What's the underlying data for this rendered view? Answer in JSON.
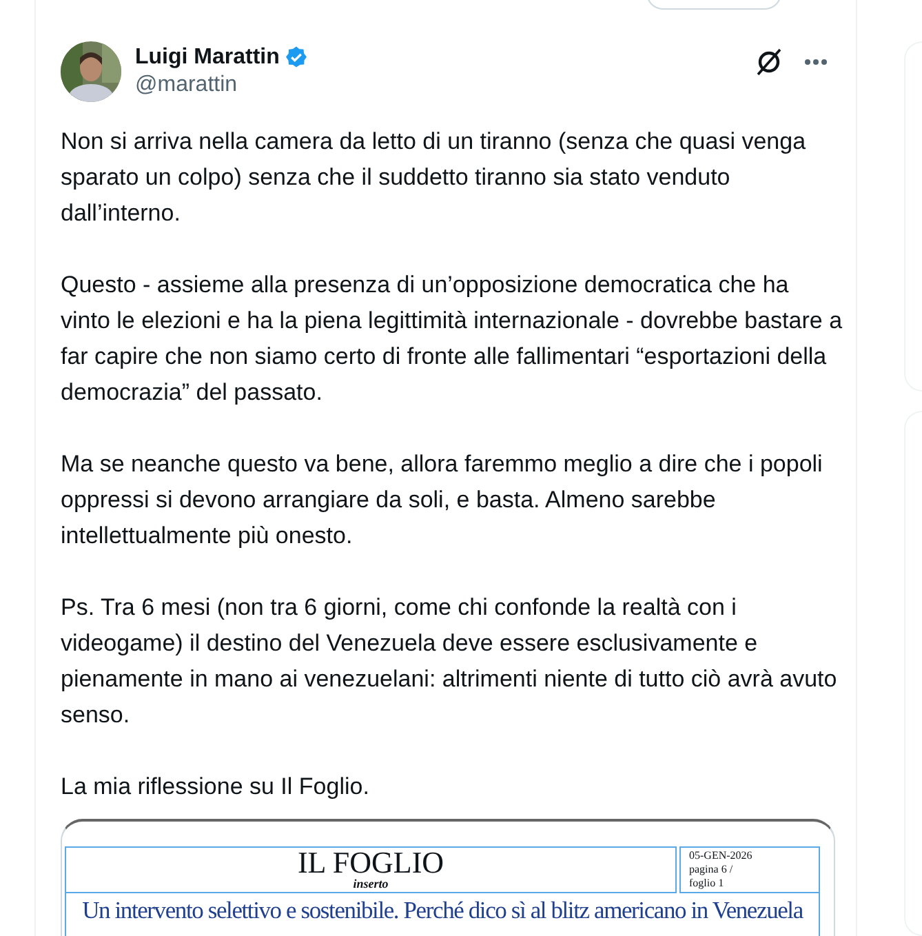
{
  "author": {
    "name": "Luigi Marattin",
    "handle": "@marattin",
    "verified": true
  },
  "paragraphs": [
    "Non si arriva nella camera da letto di un tiranno (senza che quasi venga sparato un colpo) senza che il suddetto tiranno sia stato venduto dall’interno.",
    "Questo - assieme alla presenza di un’opposizione democratica che ha vinto le elezioni e ha la piena legittimità internazionale - dovrebbe bastare a far capire che non siamo certo di fronte alle fallimentari “esportazioni della democrazia” del passato.",
    "Ma se neanche questo va bene, allora faremmo meglio a dire che i popoli oppressi si devono arrangiare da soli, e basta. Almeno sarebbe intellettualmente più onesto.",
    "Ps. Tra 6 mesi (non tra 6 giorni, come chi confonde la realtà con i videogame) il destino del Venezuela deve essere esclusivamente e pienamente in mano ai venezuelani: altrimenti niente di tutto ciò avrà avuto senso.",
    "La mia riflessione su Il Foglio."
  ],
  "clipping": {
    "masthead": "IL FOGLIO",
    "section": "inserto",
    "date": "05-GEN-2026",
    "page": "pagina 6 /",
    "sheet": "foglio  1",
    "headline": "Un intervento selettivo e sostenibile. Perché dico sì al blitz americano in Venezuela"
  }
}
